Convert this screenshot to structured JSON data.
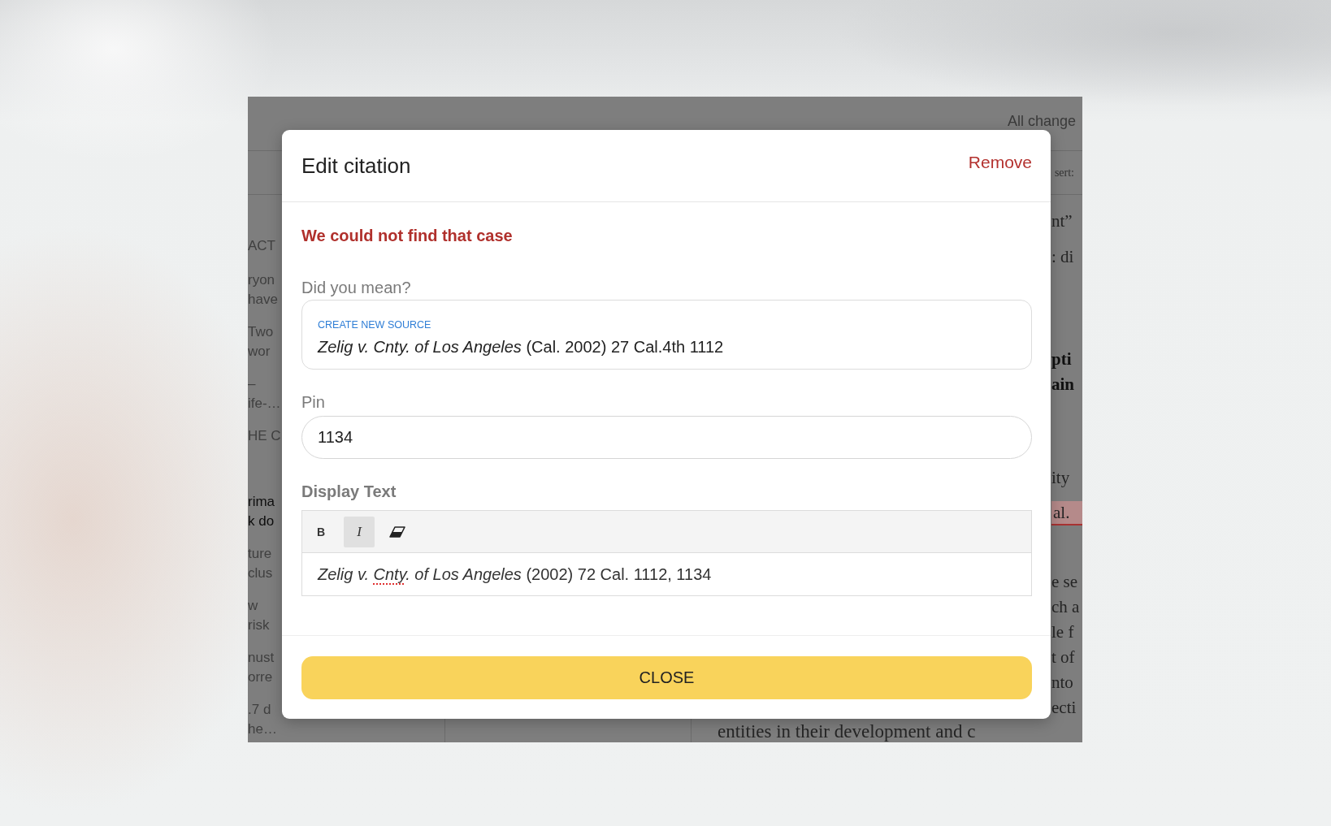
{
  "backdrop": {
    "status_text": "All change",
    "toolbar_text": "sert:",
    "left_column": [
      {
        "kind": "body",
        "lines": [
          "ACT"
        ]
      },
      {
        "kind": "body",
        "lines": [
          "ryon",
          "have"
        ]
      },
      {
        "kind": "body",
        "lines": [
          "Two",
          "wor"
        ]
      },
      {
        "kind": "body",
        "lines": [
          "–",
          "ife-…"
        ]
      },
      {
        "kind": "body",
        "lines": [
          "HE C"
        ]
      },
      {
        "kind": "dark",
        "lines": [
          "rima",
          "k do"
        ]
      },
      {
        "kind": "body",
        "lines": [
          "ture",
          "clus"
        ]
      },
      {
        "kind": "body",
        "lines": [
          "w",
          "risk"
        ]
      },
      {
        "kind": "body",
        "lines": [
          "nust",
          "orre"
        ]
      },
      {
        "kind": "body",
        "lines": [
          ".7 d",
          "he…"
        ]
      }
    ],
    "right_column": [
      {
        "kind": "plain",
        "lines": [
          "nt”"
        ]
      },
      {
        "kind": "plain",
        "lines": [
          ": di"
        ]
      },
      {
        "kind": "bold",
        "lines": [
          "pti",
          "ain"
        ]
      },
      {
        "kind": "plain",
        "lines": [
          "ity"
        ]
      },
      {
        "kind": "highlighted",
        "lines": [
          "al."
        ]
      },
      {
        "kind": "plain",
        "lines": [
          "e se",
          "ch a",
          "le f",
          "t of",
          "nto",
          "ecti"
        ]
      }
    ],
    "bottom_line": "entities in their development and c"
  },
  "dialog": {
    "title": "Edit citation",
    "remove_link": "Remove",
    "error": "We could not find that case",
    "suggestion": {
      "label": "Did you mean?",
      "action": "CREATE NEW SOURCE",
      "citation": "*Zelig v. Cnty. of Los Angeles* (Cal. 2002) 27 Cal.4th 1112"
    },
    "pin": {
      "label": "Pin",
      "value": "1134"
    },
    "display_text": {
      "label": "Display Text",
      "toolbar": [
        {
          "kind": "bold",
          "label": "B",
          "on": false
        },
        {
          "kind": "italic",
          "label": "I",
          "on": true
        },
        {
          "kind": "clear_formatting",
          "on": false
        }
      ],
      "segments": [
        {
          "text": "Zelig v. ",
          "italic": true,
          "misspelled": false
        },
        {
          "text": "Cnty",
          "italic": true,
          "misspelled": true
        },
        {
          "text": ". of Los Angeles",
          "italic": true,
          "misspelled": false
        },
        {
          "text": " (2002) 72 Cal. 1112, 1134",
          "italic": false,
          "misspelled": false
        }
      ]
    },
    "close_button": "CLOSE"
  }
}
